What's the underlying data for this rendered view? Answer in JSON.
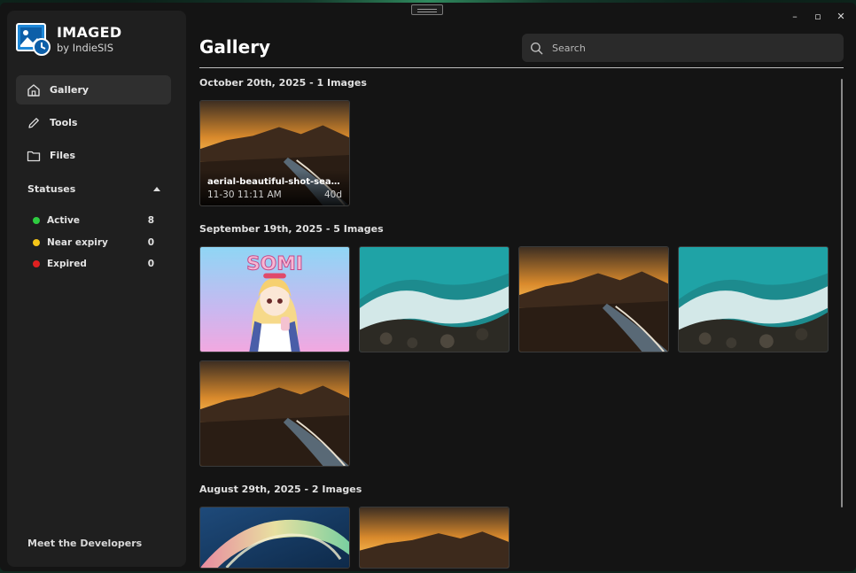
{
  "window": {
    "controls": {
      "minimize": "–",
      "maximize": "▫",
      "close": "✕"
    }
  },
  "brand": {
    "title": "IMAGED",
    "subtitle": "by IndieSIS"
  },
  "nav": {
    "items": [
      {
        "label": "Gallery",
        "icon": "home-icon",
        "active": true
      },
      {
        "label": "Tools",
        "icon": "pencil-icon",
        "active": false
      },
      {
        "label": "Files",
        "icon": "folder-icon",
        "active": false
      }
    ]
  },
  "statuses": {
    "title": "Statuses",
    "items": [
      {
        "label": "Active",
        "count": "8",
        "color": "#2ecc40"
      },
      {
        "label": "Near expiry",
        "count": "0",
        "color": "#f5c518"
      },
      {
        "label": "Expired",
        "count": "0",
        "color": "#e02020"
      }
    ]
  },
  "footer": {
    "meet_developers": "Meet the Developers"
  },
  "main": {
    "title": "Gallery",
    "search": {
      "placeholder": "Search",
      "value": ""
    },
    "sections": [
      {
        "title": "October 20th, 2025 - 1 Images",
        "images": [
          {
            "kind": "beach",
            "name": "aerial-beautiful-shot-seash...",
            "time": "11-30 11:11 AM",
            "expiry": "40d"
          }
        ]
      },
      {
        "title": "September 19th, 2025 - 5 Images",
        "images": [
          {
            "kind": "anime",
            "overlay_text": "SOMI"
          },
          {
            "kind": "waves"
          },
          {
            "kind": "beach"
          },
          {
            "kind": "waves"
          },
          {
            "kind": "beach"
          }
        ]
      },
      {
        "title": "August 29th, 2025 - 2 Images",
        "images": [
          {
            "kind": "abstract"
          },
          {
            "kind": "beach"
          }
        ]
      }
    ]
  },
  "colors": {
    "accent_bg": "#141414",
    "sidebar_bg": "#1f1f1f",
    "active_item": "#2f2f2f",
    "search_bg": "#2a2a2a"
  }
}
